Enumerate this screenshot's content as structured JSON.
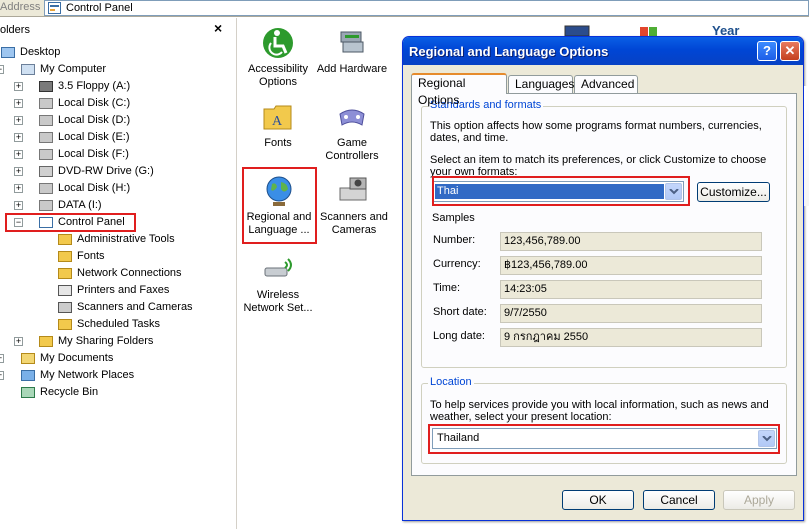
{
  "address": {
    "label": "Address",
    "value": "Control Panel"
  },
  "folders": {
    "title": "olders",
    "close": "×",
    "items": [
      {
        "label": "Desktop",
        "icon": "desktop-icon",
        "indent": 0,
        "expander": ""
      },
      {
        "label": "My Computer",
        "icon": "computer-icon",
        "indent": 1,
        "expander": "−"
      },
      {
        "label": "3.5 Floppy (A:)",
        "icon": "floppy-icon",
        "indent": 2,
        "expander": "+"
      },
      {
        "label": "Local Disk (C:)",
        "icon": "drive-icon",
        "indent": 2,
        "expander": "+"
      },
      {
        "label": "Local Disk (D:)",
        "icon": "drive-icon",
        "indent": 2,
        "expander": "+"
      },
      {
        "label": "Local Disk (E:)",
        "icon": "drive-icon",
        "indent": 2,
        "expander": "+"
      },
      {
        "label": "Local Disk (F:)",
        "icon": "drive-icon",
        "indent": 2,
        "expander": "+"
      },
      {
        "label": "DVD-RW Drive (G:)",
        "icon": "dvd-icon",
        "indent": 2,
        "expander": "+"
      },
      {
        "label": "Local Disk (H:)",
        "icon": "drive-icon",
        "indent": 2,
        "expander": "+"
      },
      {
        "label": "DATA (I:)",
        "icon": "drive-icon",
        "indent": 2,
        "expander": "+"
      },
      {
        "label": "Control Panel",
        "icon": "control-panel-icon",
        "indent": 2,
        "expander": "−"
      },
      {
        "label": "Administrative Tools",
        "icon": "folder-icon",
        "indent": 3,
        "expander": ""
      },
      {
        "label": "Fonts",
        "icon": "folder-icon",
        "indent": 3,
        "expander": ""
      },
      {
        "label": "Network Connections",
        "icon": "network-icon",
        "indent": 3,
        "expander": ""
      },
      {
        "label": "Printers and Faxes",
        "icon": "printer-icon",
        "indent": 3,
        "expander": ""
      },
      {
        "label": "Scanners and Cameras",
        "icon": "scanner-icon",
        "indent": 3,
        "expander": ""
      },
      {
        "label": "Scheduled Tasks",
        "icon": "folder-icon",
        "indent": 3,
        "expander": ""
      },
      {
        "label": "My Sharing Folders",
        "icon": "shared-folder-icon",
        "indent": 2,
        "expander": "+"
      },
      {
        "label": "My Documents",
        "icon": "documents-icon",
        "indent": 1,
        "expander": "+"
      },
      {
        "label": "My Network Places",
        "icon": "network-places-icon",
        "indent": 1,
        "expander": "+"
      },
      {
        "label": "Recycle Bin",
        "icon": "recycle-bin-icon",
        "indent": 1,
        "expander": ""
      }
    ]
  },
  "control_panel_items": {
    "accessibility": {
      "line1": "Accessibility",
      "line2": "Options"
    },
    "add_hardware": {
      "line1": "Add Hardware",
      "line2": ""
    },
    "fonts": {
      "line1": "Fonts",
      "line2": ""
    },
    "game_controllers": {
      "line1": "Game",
      "line2": "Controllers"
    },
    "regional": {
      "line1": "Regional and",
      "line2": "Language ..."
    },
    "scanners": {
      "line1": "Scanners and",
      "line2": "Cameras"
    },
    "wireless": {
      "line1": "Wireless",
      "line2": "Network Set..."
    },
    "partial_label": "Year"
  },
  "dialog": {
    "title": "Regional and Language Options",
    "help": "?",
    "close": "✕",
    "tabs": [
      "Regional Options",
      "Languages",
      "Advanced"
    ],
    "standards": {
      "group_title": "Standards and formats",
      "desc_line1": "This option affects how some programs format numbers, currencies,",
      "desc_line2": "dates, and time.",
      "select_line1": "Select an item to match its preferences, or click Customize to choose",
      "select_line2": "your own formats:",
      "format_value": "Thai",
      "customize": "Customize..."
    },
    "samples": {
      "title": "Samples",
      "rows": [
        {
          "label": "Number:",
          "value": "123,456,789.00"
        },
        {
          "label": "Currency:",
          "value": "฿123,456,789.00"
        },
        {
          "label": "Time:",
          "value": "14:23:05"
        },
        {
          "label": "Short date:",
          "value": "9/7/2550"
        },
        {
          "label": "Long date:",
          "value": "9 กรกฎาคม 2550"
        }
      ]
    },
    "location": {
      "group_title": "Location",
      "desc_line1": "To help services provide you with local information, such as news and",
      "desc_line2": "weather, select your present location:",
      "value": "Thailand"
    },
    "buttons": {
      "ok": "OK",
      "cancel": "Cancel",
      "apply": "Apply"
    }
  },
  "colors": {
    "highlight": "#e01e1e",
    "title_blue": "#0046d5",
    "selection": "#316ac5"
  }
}
